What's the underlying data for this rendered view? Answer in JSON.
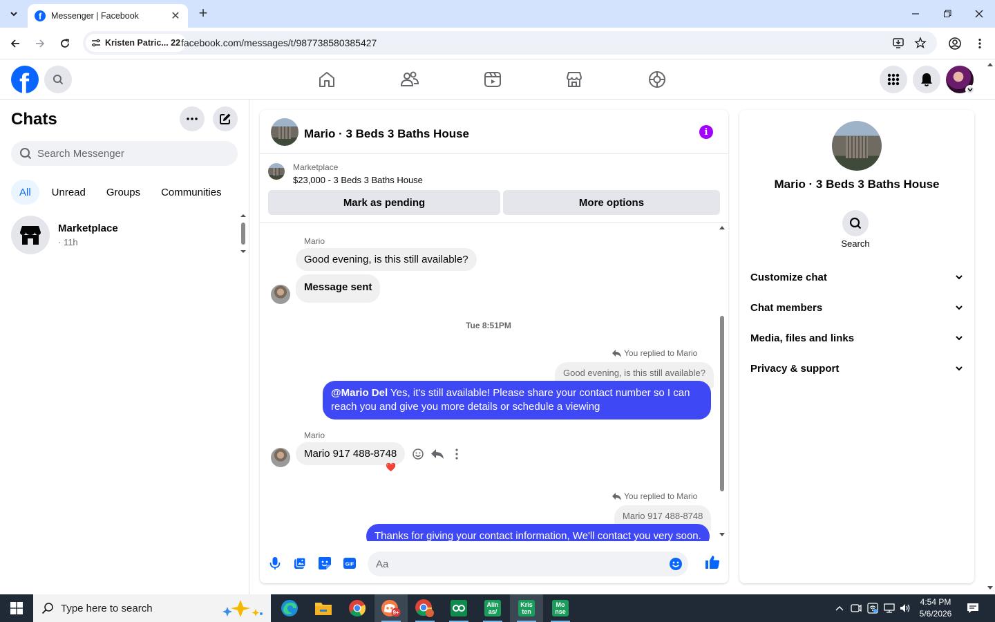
{
  "browser": {
    "tab_title": "Messenger | Facebook",
    "profile_chip": "Kristen Patric... 22",
    "url": "facebook.com/messages/t/987738580385427"
  },
  "sidebar": {
    "title": "Chats",
    "search_placeholder": "Search Messenger",
    "filters": [
      "All",
      "Unread",
      "Groups",
      "Communities"
    ],
    "active_filter": "All",
    "conversations": [
      {
        "name": "Marketplace",
        "time": "· 11h"
      }
    ]
  },
  "chat": {
    "title": "Mario · 3 Beds 3 Baths House",
    "marketplace_label": "Marketplace",
    "listing": "$23,000 - 3 Beds 3 Baths House",
    "mark_pending_label": "Mark as pending",
    "more_options_label": "More options",
    "messages": {
      "sender1": "Mario",
      "msg1": "Good evening, is this still available?",
      "msg2": "Message sent",
      "timestamp": "Tue 8:51PM",
      "reply_note1": "You replied to Mario",
      "quoted1": "Good evening, is this still available?",
      "out1_mention": "@Mario Del",
      "out1_text": " Yes, it's still available! Please share your contact number so I can reach you and give you more details or schedule a viewing",
      "sender2": "Mario",
      "msg3": "Mario 917 488-8748",
      "reaction": "❤️",
      "reply_note2": "You replied to Mario",
      "quoted2": "Mario 917 488-8748",
      "out2_text": "Thanks for giving your contact information, We'll contact you very soon."
    },
    "composer_placeholder": "Aa"
  },
  "details": {
    "name": "Mario · 3 Beds 3 Baths House",
    "search_label": "Search",
    "sections": [
      "Customize chat",
      "Chat members",
      "Media, files and links",
      "Privacy & support"
    ]
  },
  "taskbar": {
    "search_placeholder": "Type here to search",
    "apps": [
      {
        "icon": "edge-icon"
      },
      {
        "icon": "file-explorer-icon"
      },
      {
        "icon": "chrome-icon"
      },
      {
        "icon": "discord-icon",
        "badge": "9+"
      },
      {
        "icon": "chrome-profile-icon"
      },
      {
        "icon": "app-oo-icon"
      },
      {
        "icon": "app-tile",
        "label": "Alin as/"
      },
      {
        "icon": "app-tile",
        "label": "Kris ten"
      },
      {
        "icon": "app-tile",
        "label": "Mo nse"
      }
    ],
    "time": "4:54 PM",
    "date": "5/6/2026"
  },
  "colors": {
    "fb_blue": "#0866ff",
    "outgoing_bubble": "#3f48f5",
    "info_purple": "#a400ff",
    "tabstrip": "#d3e3fd",
    "taskbar": "#1f2a36"
  }
}
